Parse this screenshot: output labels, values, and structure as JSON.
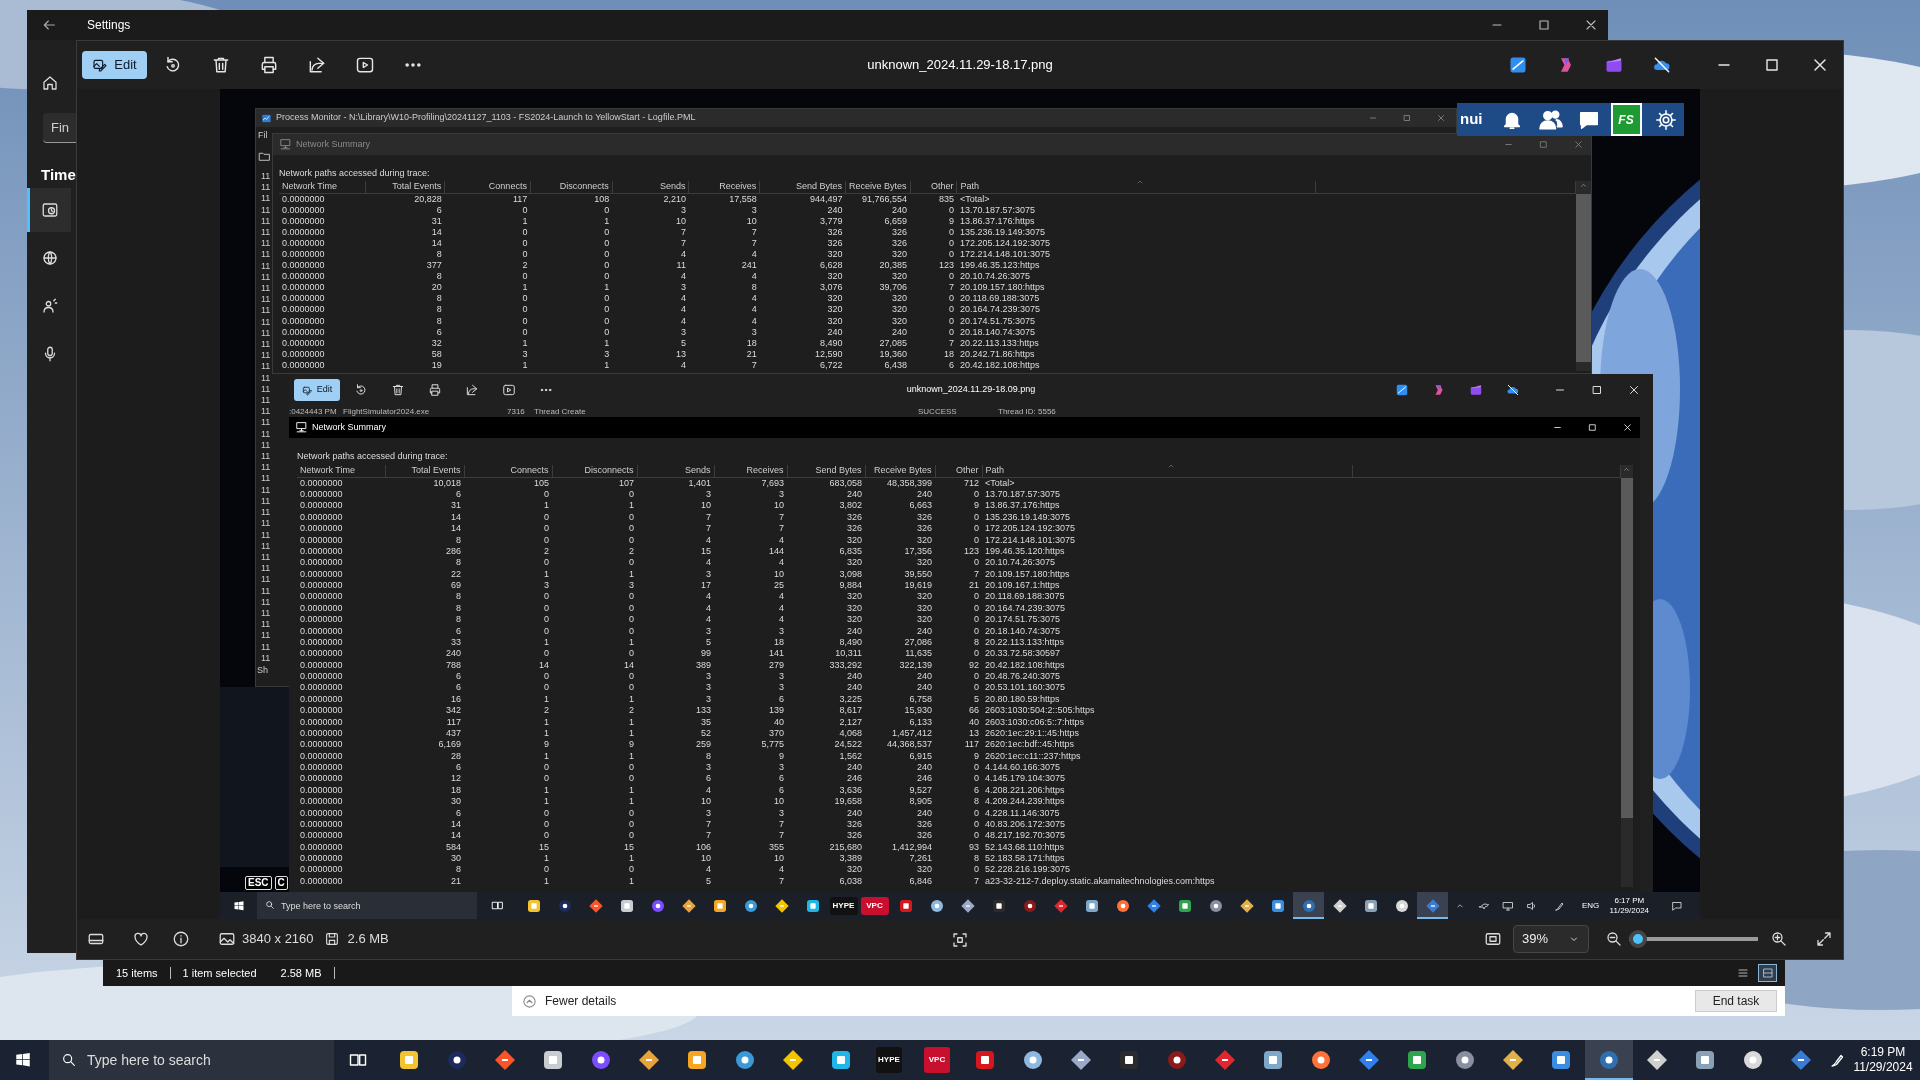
{
  "settings_window": {
    "title": "Settings",
    "search": {
      "placeholder": "Fin"
    },
    "section": "Time",
    "nav_items": [
      {
        "selected": true
      },
      {
        "selected": false
      },
      {
        "selected": false
      },
      {
        "selected": false
      }
    ]
  },
  "explorer_status": {
    "item_count": "15 items",
    "selection": "1 item selected",
    "selection_size": "2.58 MB",
    "views": [
      {
        "selected": false
      },
      {
        "selected": true
      }
    ]
  },
  "task_manager": {
    "details_toggle": "Fewer details",
    "end_task": "End task"
  },
  "photos": {
    "title": "unknown_2024.11.29-18.17.png",
    "edit": "Edit",
    "dimensions": "3840 x 2160",
    "file_size": "2.6 MB",
    "zoom_text": "39%",
    "zoom_slider": {
      "level": 0.07
    }
  },
  "screenshot": {
    "game_bar": {
      "user": "nui",
      "shop_label": "FS"
    },
    "procmon": {
      "title": "Process Monitor - N:\\Library\\W10-Profiling\\20241127_1103 - FS2024-Launch to YellowStart - Logfile.PML",
      "menu": "Fil",
      "event_times": [
        "11",
        "11",
        "11",
        "11",
        "11",
        "11",
        "11",
        "11",
        "11",
        "11",
        "11",
        "11",
        "11",
        "11",
        "11",
        "11",
        "11",
        "11",
        "11",
        "11",
        "11",
        "11",
        "11",
        "11",
        "11",
        "11",
        "11",
        "11",
        "11",
        "11",
        "11",
        "11",
        "11",
        "11",
        "11",
        "11",
        "11",
        "11",
        "11",
        "11",
        "11",
        "11",
        "11",
        "11"
      ],
      "status": "Sh"
    },
    "summary_top": {
      "title": "Network Summary",
      "active": false,
      "caption": "Network paths accessed during trace:",
      "columns": [
        {
          "label": "Network Time",
          "sorted": false
        },
        {
          "label": "Total Events",
          "sorted": false
        },
        {
          "label": "Connects",
          "sorted": false
        },
        {
          "label": "Disconnects",
          "sorted": false
        },
        {
          "label": "Sends",
          "sorted": false
        },
        {
          "label": "Receives",
          "sorted": false
        },
        {
          "label": "Send Bytes",
          "sorted": false
        },
        {
          "label": "Receive Bytes",
          "sorted": false
        },
        {
          "label": "Other",
          "sorted": false
        },
        {
          "label": "Path",
          "sorted": true
        }
      ],
      "rows": [
        [
          "0.0000000",
          "20,828",
          "117",
          "108",
          "2,210",
          "17,558",
          "944,497",
          "91,766,554",
          "835",
          "<Total>"
        ],
        [
          "0.0000000",
          "6",
          "0",
          "0",
          "3",
          "3",
          "240",
          "240",
          "0",
          "13.70.187.57:3075"
        ],
        [
          "0.0000000",
          "31",
          "1",
          "1",
          "10",
          "10",
          "3,779",
          "6,659",
          "9",
          "13.86.37.176:https"
        ],
        [
          "0.0000000",
          "14",
          "0",
          "0",
          "7",
          "7",
          "326",
          "326",
          "0",
          "135.236.19.149:3075"
        ],
        [
          "0.0000000",
          "14",
          "0",
          "0",
          "7",
          "7",
          "326",
          "326",
          "0",
          "172.205.124.192:3075"
        ],
        [
          "0.0000000",
          "8",
          "0",
          "0",
          "4",
          "4",
          "320",
          "320",
          "0",
          "172.214.148.101:3075"
        ],
        [
          "0.0000000",
          "377",
          "2",
          "0",
          "11",
          "241",
          "6,628",
          "20,385",
          "123",
          "199.46.35.123:https"
        ],
        [
          "0.0000000",
          "8",
          "0",
          "0",
          "4",
          "4",
          "320",
          "320",
          "0",
          "20.10.74.26:3075"
        ],
        [
          "0.0000000",
          "20",
          "1",
          "1",
          "3",
          "8",
          "3,076",
          "39,706",
          "7",
          "20.109.157.180:https"
        ],
        [
          "0.0000000",
          "8",
          "0",
          "0",
          "4",
          "4",
          "320",
          "320",
          "0",
          "20.118.69.188:3075"
        ],
        [
          "0.0000000",
          "8",
          "0",
          "0",
          "4",
          "4",
          "320",
          "320",
          "0",
          "20.164.74.239:3075"
        ],
        [
          "0.0000000",
          "8",
          "0",
          "0",
          "4",
          "4",
          "320",
          "320",
          "0",
          "20.174.51.75:3075"
        ],
        [
          "0.0000000",
          "6",
          "0",
          "0",
          "3",
          "3",
          "240",
          "240",
          "0",
          "20.18.140.74:3075"
        ],
        [
          "0.0000000",
          "32",
          "1",
          "1",
          "5",
          "18",
          "8,490",
          "27,085",
          "7",
          "20.22.113.133:https"
        ],
        [
          "0.0000000",
          "58",
          "3",
          "3",
          "13",
          "21",
          "12,590",
          "19,360",
          "18",
          "20.242.71.86:https"
        ],
        [
          "0.0000000",
          "19",
          "1",
          "1",
          "4",
          "7",
          "6,722",
          "6,438",
          "6",
          "20.42.182.108:https"
        ]
      ]
    },
    "inner_photos": {
      "title": "unknown_2024.11.29-18.09.png",
      "edit": "Edit",
      "event_row": [
        ":0424443 PM",
        "FlightSimulator2024.exe",
        "7316",
        "Thread Create",
        "SUCCESS",
        "Thread ID: 5556"
      ],
      "summary": {
        "title": "Network Summary",
        "active": true,
        "caption": "Network paths accessed during trace:",
        "columns": [
          {
            "label": "Network Time",
            "sorted": false
          },
          {
            "label": "Total Events",
            "sorted": false
          },
          {
            "label": "Connects",
            "sorted": false
          },
          {
            "label": "Disconnects",
            "sorted": false
          },
          {
            "label": "Sends",
            "sorted": false
          },
          {
            "label": "Receives",
            "sorted": false
          },
          {
            "label": "Send Bytes",
            "sorted": false
          },
          {
            "label": "Receive Bytes",
            "sorted": false
          },
          {
            "label": "Other",
            "sorted": false
          },
          {
            "label": "Path",
            "sorted": true
          }
        ],
        "rows": [
          [
            "0.0000000",
            "10,018",
            "105",
            "107",
            "1,401",
            "7,693",
            "683,058",
            "48,358,399",
            "712",
            "<Total>"
          ],
          [
            "0.0000000",
            "6",
            "0",
            "0",
            "3",
            "3",
            "240",
            "240",
            "0",
            "13.70.187.57:3075"
          ],
          [
            "0.0000000",
            "31",
            "1",
            "1",
            "10",
            "10",
            "3,802",
            "6,663",
            "9",
            "13.86.37.176:https"
          ],
          [
            "0.0000000",
            "14",
            "0",
            "0",
            "7",
            "7",
            "326",
            "326",
            "0",
            "135.236.19.149:3075"
          ],
          [
            "0.0000000",
            "14",
            "0",
            "0",
            "7",
            "7",
            "326",
            "326",
            "0",
            "172.205.124.192:3075"
          ],
          [
            "0.0000000",
            "8",
            "0",
            "0",
            "4",
            "4",
            "320",
            "320",
            "0",
            "172.214.148.101:3075"
          ],
          [
            "0.0000000",
            "286",
            "2",
            "2",
            "15",
            "144",
            "6,835",
            "17,356",
            "123",
            "199.46.35.120:https"
          ],
          [
            "0.0000000",
            "8",
            "0",
            "0",
            "4",
            "4",
            "320",
            "320",
            "0",
            "20.10.74.26:3075"
          ],
          [
            "0.0000000",
            "22",
            "1",
            "1",
            "3",
            "10",
            "3,098",
            "39,550",
            "7",
            "20.109.157.180:https"
          ],
          [
            "0.0000000",
            "69",
            "3",
            "3",
            "17",
            "25",
            "9,884",
            "19,619",
            "21",
            "20.109.167.1:https"
          ],
          [
            "0.0000000",
            "8",
            "0",
            "0",
            "4",
            "4",
            "320",
            "320",
            "0",
            "20.118.69.188:3075"
          ],
          [
            "0.0000000",
            "8",
            "0",
            "0",
            "4",
            "4",
            "320",
            "320",
            "0",
            "20.164.74.239:3075"
          ],
          [
            "0.0000000",
            "8",
            "0",
            "0",
            "4",
            "4",
            "320",
            "320",
            "0",
            "20.174.51.75:3075"
          ],
          [
            "0.0000000",
            "6",
            "0",
            "0",
            "3",
            "3",
            "240",
            "240",
            "0",
            "20.18.140.74:3075"
          ],
          [
            "0.0000000",
            "33",
            "1",
            "1",
            "5",
            "18",
            "8,490",
            "27,086",
            "8",
            "20.22.113.133:https"
          ],
          [
            "0.0000000",
            "240",
            "0",
            "0",
            "99",
            "141",
            "10,311",
            "11,635",
            "0",
            "20.33.72.58:30597"
          ],
          [
            "0.0000000",
            "788",
            "14",
            "14",
            "389",
            "279",
            "333,292",
            "322,139",
            "92",
            "20.42.182.108:https"
          ],
          [
            "0.0000000",
            "6",
            "0",
            "0",
            "3",
            "3",
            "240",
            "240",
            "0",
            "20.48.76.240:3075"
          ],
          [
            "0.0000000",
            "6",
            "0",
            "0",
            "3",
            "3",
            "240",
            "240",
            "0",
            "20.53.101.160:3075"
          ],
          [
            "0.0000000",
            "16",
            "1",
            "1",
            "3",
            "6",
            "3,225",
            "6,758",
            "5",
            "20.80.180.59:https"
          ],
          [
            "0.0000000",
            "342",
            "2",
            "2",
            "133",
            "139",
            "8,617",
            "15,930",
            "66",
            "2603:1030:504:2::505:https"
          ],
          [
            "0.0000000",
            "117",
            "1",
            "1",
            "35",
            "40",
            "2,127",
            "6,133",
            "40",
            "2603:1030:c06:5::7:https"
          ],
          [
            "0.0000000",
            "437",
            "1",
            "1",
            "52",
            "370",
            "4,068",
            "1,457,412",
            "13",
            "2620:1ec:29:1::45:https"
          ],
          [
            "0.0000000",
            "6,169",
            "9",
            "9",
            "259",
            "5,775",
            "24,522",
            "44,368,537",
            "117",
            "2620:1ec:bdf::45:https"
          ],
          [
            "0.0000000",
            "28",
            "1",
            "1",
            "8",
            "9",
            "1,562",
            "6,915",
            "9",
            "2620:1ec:c11::237:https"
          ],
          [
            "0.0000000",
            "6",
            "0",
            "0",
            "3",
            "3",
            "240",
            "240",
            "0",
            "4.144.60.166:3075"
          ],
          [
            "0.0000000",
            "12",
            "0",
            "0",
            "6",
            "6",
            "246",
            "246",
            "0",
            "4.145.179.104:3075"
          ],
          [
            "0.0000000",
            "18",
            "1",
            "1",
            "4",
            "6",
            "3,636",
            "9,527",
            "6",
            "4.208.221.206:https"
          ],
          [
            "0.0000000",
            "30",
            "1",
            "1",
            "10",
            "10",
            "19,658",
            "8,905",
            "8",
            "4.209.244.239:https"
          ],
          [
            "0.0000000",
            "6",
            "0",
            "0",
            "3",
            "3",
            "240",
            "240",
            "0",
            "4.228.11.146:3075"
          ],
          [
            "0.0000000",
            "14",
            "0",
            "0",
            "7",
            "7",
            "326",
            "326",
            "0",
            "40.83.206.172:3075"
          ],
          [
            "0.0000000",
            "14",
            "0",
            "0",
            "7",
            "7",
            "326",
            "326",
            "0",
            "48.217.192.70:3075"
          ],
          [
            "0.0000000",
            "584",
            "15",
            "15",
            "106",
            "355",
            "215,680",
            "1,412,994",
            "93",
            "52.143.68.110:https"
          ],
          [
            "0.0000000",
            "30",
            "1",
            "1",
            "10",
            "10",
            "3,389",
            "7,261",
            "8",
            "52.183.58.171:https"
          ],
          [
            "0.0000000",
            "8",
            "0",
            "0",
            "4",
            "4",
            "320",
            "320",
            "0",
            "52.228.216.199:3075"
          ],
          [
            "0.0000000",
            "21",
            "1",
            "1",
            "5",
            "7",
            "6,038",
            "6,846",
            "7",
            "a23-32-212-7.deploy.static.akamaitechnologies.com:https"
          ]
        ]
      }
    },
    "keys": [
      "ESC",
      "C"
    ],
    "taskbar": {
      "search_placeholder": "Type here to search",
      "language": "ENG",
      "time": "6:17 PM",
      "date": "11/29/2024",
      "apps": [
        {
          "color": "#f4c430",
          "selected": false
        },
        {
          "color": "#1c2a5c",
          "selected": false
        },
        {
          "color": "#fb542b",
          "selected": false
        },
        {
          "color": "#c9ccd1",
          "selected": false
        },
        {
          "color": "#7b4dff",
          "selected": false
        },
        {
          "color": "#e8a33d",
          "selected": false
        },
        {
          "color": "#f5a623",
          "selected": false
        },
        {
          "color": "#3a9ad9",
          "selected": false
        },
        {
          "color": "#f5c400",
          "selected": false
        },
        {
          "color": "#1fb6e8",
          "selected": false
        },
        {
          "color": "#111111",
          "label": "HYPE",
          "selected": false
        },
        {
          "color": "#c8102e",
          "label": "VPC",
          "selected": false
        },
        {
          "color": "#d6181e",
          "selected": false
        },
        {
          "color": "#8fb8e0",
          "selected": false
        },
        {
          "color": "#9aa9c9",
          "selected": false
        },
        {
          "color": "#2b2b2b",
          "selected": false
        },
        {
          "color": "#8b1a1a",
          "selected": false
        },
        {
          "color": "#e0262e",
          "selected": false
        },
        {
          "color": "#7fa7c9",
          "selected": false
        },
        {
          "color": "#ff7139",
          "selected": false
        },
        {
          "color": "#2f80ed",
          "selected": false
        },
        {
          "color": "#2ea44f",
          "selected": false
        },
        {
          "color": "#8a8fa0",
          "selected": false
        },
        {
          "color": "#e2b04a",
          "selected": false
        },
        {
          "color": "#3b8de0",
          "selected": false
        },
        {
          "color": "#2f6fb0",
          "selected": true
        },
        {
          "color": "#d0d0d0",
          "selected": false
        },
        {
          "color": "#8aa0b5",
          "selected": false
        },
        {
          "color": "#d9d9d9",
          "selected": false
        },
        {
          "color": "#3a7bd5",
          "selected": true
        }
      ]
    }
  },
  "taskbar": {
    "search_placeholder": "Type here to search",
    "time": "6:19 PM",
    "date": "11/29/2024",
    "apps": [
      {
        "color": "#f4c430",
        "selected": false
      },
      {
        "color": "#1c2a5c",
        "selected": false
      },
      {
        "color": "#fb542b",
        "selected": false
      },
      {
        "color": "#c9ccd1",
        "selected": false
      },
      {
        "color": "#7b4dff",
        "selected": false
      },
      {
        "color": "#e8a33d",
        "selected": false
      },
      {
        "color": "#f5a623",
        "selected": false
      },
      {
        "color": "#3a9ad9",
        "selected": false
      },
      {
        "color": "#f5c400",
        "selected": false
      },
      {
        "color": "#1fb6e8",
        "selected": false
      },
      {
        "color": "#111111",
        "label": "HYPE",
        "selected": false
      },
      {
        "color": "#c8102e",
        "label": "VPC",
        "selected": false
      },
      {
        "color": "#d6181e",
        "selected": false
      },
      {
        "color": "#8fb8e0",
        "selected": false
      },
      {
        "color": "#9aa9c9",
        "selected": false
      },
      {
        "color": "#2b2b2b",
        "selected": false
      },
      {
        "color": "#8b1a1a",
        "selected": false
      },
      {
        "color": "#e0262e",
        "selected": false
      },
      {
        "color": "#7fa7c9",
        "selected": false
      },
      {
        "color": "#ff7139",
        "selected": false
      },
      {
        "color": "#2f80ed",
        "selected": false
      },
      {
        "color": "#2ea44f",
        "selected": false
      },
      {
        "color": "#8a8fa0",
        "selected": false
      },
      {
        "color": "#e2b04a",
        "selected": false
      },
      {
        "color": "#3b8de0",
        "selected": false
      },
      {
        "color": "#2f6fb0",
        "selected": true
      },
      {
        "color": "#d0d0d0",
        "selected": false
      },
      {
        "color": "#8aa0b5",
        "selected": false
      },
      {
        "color": "#d9d9d9",
        "selected": false
      },
      {
        "color": "#3a7bd5",
        "selected": false
      }
    ]
  }
}
